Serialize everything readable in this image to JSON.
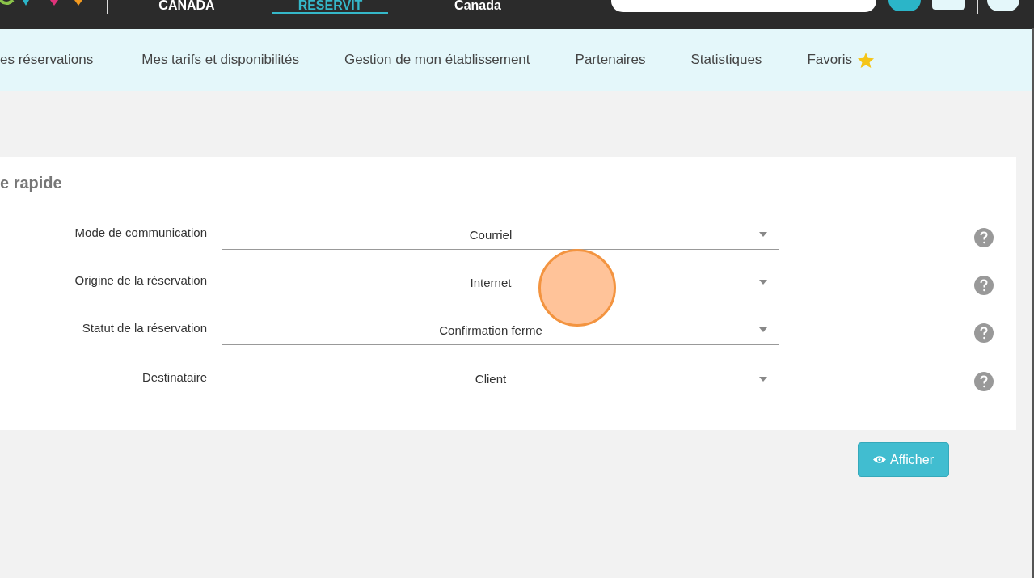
{
  "top_nav": {
    "items": [
      {
        "label": "CANADA",
        "selected": false
      },
      {
        "label": "RESERVIT",
        "selected": true
      },
      {
        "label": "Canada",
        "selected": false
      }
    ]
  },
  "main_menu": {
    "items": [
      {
        "label": "es réservations",
        "kind": "text"
      },
      {
        "label": "Mes tarifs et disponibilités",
        "kind": "text"
      },
      {
        "label": "Gestion de mon établissement",
        "kind": "text"
      },
      {
        "label": "Partenaires",
        "kind": "text"
      },
      {
        "label": "Statistiques",
        "kind": "text"
      },
      {
        "label": "Favoris",
        "kind": "star"
      }
    ]
  },
  "panel": {
    "title": "e rapide",
    "fields": [
      {
        "label": "Mode de communication",
        "value": "Courriel"
      },
      {
        "label": "Origine de la réservation",
        "value": "Internet"
      },
      {
        "label": "Statut de la réservation",
        "value": "Confirmation ferme"
      },
      {
        "label": "Destinataire",
        "value": "Client"
      }
    ]
  },
  "button": {
    "label": "Afficher"
  }
}
